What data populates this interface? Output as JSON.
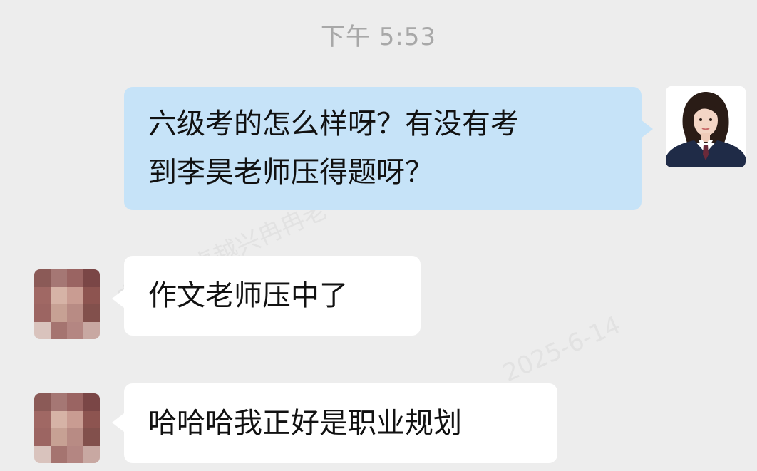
{
  "chat": {
    "timestamp": "下午 5:53",
    "watermark_lines": [
      "冉老师(卓越兴冉冉老",
      "2025-6-14"
    ],
    "messages": [
      {
        "sender": "self",
        "lines": [
          "六级考的怎么样呀？有没有考",
          "到李昊老师压得题呀？"
        ]
      },
      {
        "sender": "other",
        "lines": [
          "作文老师压中了"
        ]
      },
      {
        "sender": "other",
        "lines": [
          "哈哈哈我正好是职业规划"
        ]
      }
    ]
  },
  "colors": {
    "background": "#ededed",
    "sent_bubble": "#c6e3f8",
    "received_bubble": "#ffffff",
    "timestamp_text": "#a8a8a8"
  },
  "icons": {
    "self_avatar": "woman-portrait-avatar",
    "other_avatar": "pixelated-avatar"
  }
}
